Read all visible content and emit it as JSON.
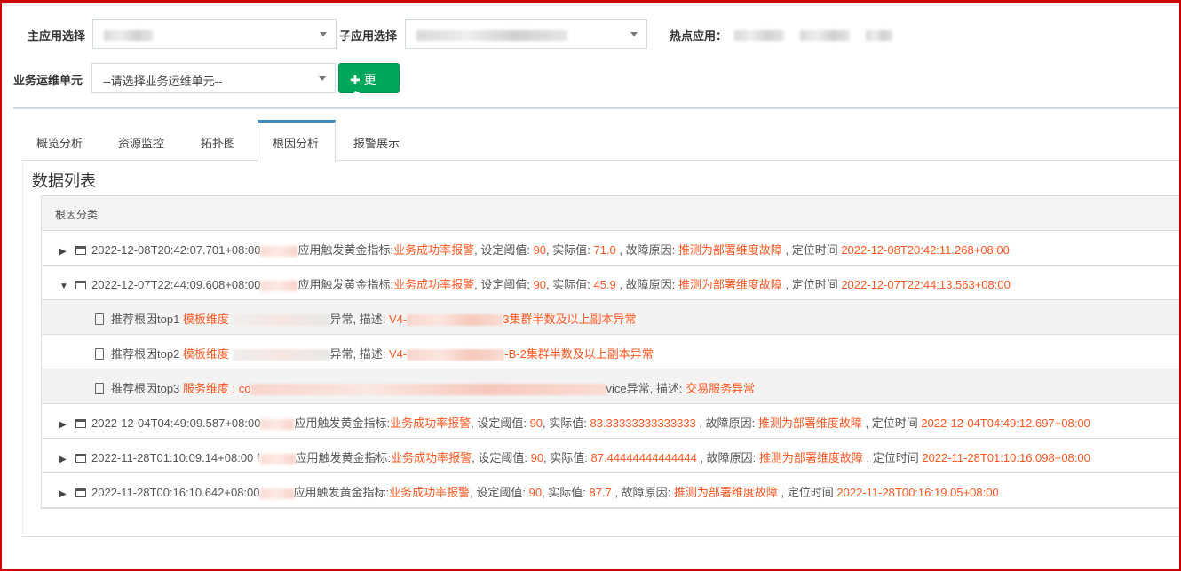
{
  "filters": {
    "main_app_label": "主应用选择",
    "sub_app_label": "子应用选择",
    "hot_app_label": "热点应用：",
    "unit_label": "业务运维单元",
    "unit_placeholder": "--请选择业务运维单元--",
    "more_button": "更多"
  },
  "tabs": [
    {
      "label": "概览分析"
    },
    {
      "label": "资源监控"
    },
    {
      "label": "拓扑图"
    },
    {
      "label": "根因分析",
      "active": true
    },
    {
      "label": "报警展示"
    }
  ],
  "section_title": "数据列表",
  "table_header": "根因分类",
  "colors": {
    "accent": "#ff5722",
    "button": "#00a65a",
    "tab_active": "#3c8dbc"
  },
  "rows": [
    {
      "expanded": false,
      "time": "2022-12-08T20:42:07.701+08:00",
      "suffix": "应用触发黄金指标:",
      "metric": "业务成功率报警",
      "threshold_label": ", 设定阈值: ",
      "threshold": "90",
      "actual_label": ", 实际值: ",
      "actual": "71.0",
      "cause_label": " , 故障原因: ",
      "cause": "推测为部署维度故障",
      "loc_label": " , 定位时间 ",
      "loc_time": "2022-12-08T20:42:11.268+08:00"
    },
    {
      "expanded": true,
      "time": "2022-12-07T22:44:09.608+08:00",
      "suffix": "应用触发黄金指标:",
      "metric": "业务成功率报警",
      "threshold_label": ", 设定阈值: ",
      "threshold": "90",
      "actual_label": ", 实际值: ",
      "actual": "45.9",
      "cause_label": " , 故障原因: ",
      "cause": "推测为部署维度故障",
      "loc_label": " , 定位时间 ",
      "loc_time": "2022-12-07T22:44:13.563+08:00",
      "children": [
        {
          "label": "推荐根因top1 ",
          "dim": "模板维度 ",
          "mid": "异常, 描述: ",
          "desc_pre": "V4-",
          "desc_post": "3集群半数及以上副本异常"
        },
        {
          "label": "推荐根因top2 ",
          "dim": "模板维度 ",
          "mid": "异常, 描述: ",
          "desc_pre": "V4-",
          "desc_post": "-B-2集群半数及以上副本异常"
        },
        {
          "label": "推荐根因top3 ",
          "dim": "服务维度 : co",
          "mid": "vice异常, 描述: ",
          "desc_pre": "",
          "desc_post": "交易服务异常"
        }
      ]
    },
    {
      "expanded": false,
      "time": "2022-12-04T04:49:09.587+08:00",
      "suffix": "应用触发黄金指标:",
      "metric": "业务成功率报警",
      "threshold_label": ", 设定阈值: ",
      "threshold": "90",
      "actual_label": ", 实际值: ",
      "actual": "83.33333333333333",
      "cause_label": " , 故障原因: ",
      "cause": "推测为部署维度故障",
      "loc_label": " , 定位时间 ",
      "loc_time": "2022-12-04T04:49:12.697+08:00"
    },
    {
      "expanded": false,
      "time": "2022-11-28T01:10:09.14+08:00 f",
      "suffix": "应用触发黄金指标:",
      "metric": "业务成功率报警",
      "threshold_label": ", 设定阈值: ",
      "threshold": "90",
      "actual_label": ", 实际值: ",
      "actual": "87.44444444444444",
      "cause_label": " , 故障原因: ",
      "cause": "推测为部署维度故障",
      "loc_label": " , 定位时间 ",
      "loc_time": "2022-11-28T01:10:16.098+08:00"
    },
    {
      "expanded": false,
      "time": "2022-11-28T00:16:10.642+08:00",
      "suffix": "应用触发黄金指标:",
      "metric": "业务成功率报警",
      "threshold_label": ", 设定阈值: ",
      "threshold": "90",
      "actual_label": ", 实际值: ",
      "actual": "87.7",
      "cause_label": " , 故障原因: ",
      "cause": "推测为部署维度故障",
      "loc_label": " , 定位时间 ",
      "loc_time": "2022-11-28T00:16:19.05+08:00"
    }
  ]
}
